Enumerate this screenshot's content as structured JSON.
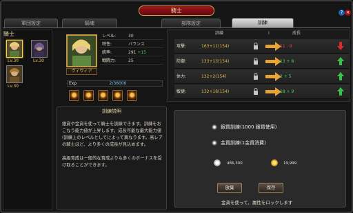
{
  "window": {
    "title": "騎士",
    "help": "?",
    "close": "×"
  },
  "tabs": [
    {
      "label": "軍団設定",
      "active": false
    },
    {
      "label": "騎魂",
      "active": false
    },
    {
      "label": "部隊設定",
      "active": false
    },
    {
      "label": "訓練",
      "active": true
    }
  ],
  "knight_list": {
    "heading": "騎士",
    "knights": [
      {
        "level": "Lv.30",
        "selected": true
      },
      {
        "level": "Lv.30",
        "selected": false
      },
      {
        "level": "Lv.30",
        "selected": false
      }
    ]
  },
  "knight": {
    "name": "ヴィヴィア",
    "stats": [
      {
        "label": "レベル:",
        "value": "30",
        "bonus": ""
      },
      {
        "label": "特性:",
        "value": "バランス",
        "bonus": ""
      },
      {
        "label": "統率:",
        "value": "291",
        "bonus": "+15"
      },
      {
        "label": "戦闘力:",
        "value": "25",
        "bonus": ""
      }
    ],
    "exp_label": "Exp",
    "exp_value": "2/36000"
  },
  "train_table": {
    "headers": {
      "train": "訓練",
      "mid": "I",
      "growth": "成長"
    },
    "rows": [
      {
        "name": "攻撃:",
        "value": "163+11(154)",
        "growth": "11 - 9",
        "trend": "down"
      },
      {
        "name": "防御:",
        "value": "133+13(154)",
        "growth": "13 + 8",
        "trend": "up"
      },
      {
        "name": "体力:",
        "value": "132+2(154)",
        "growth": "2 + 5",
        "trend": "up"
      },
      {
        "name": "敏捷:",
        "value": "132+18(154)",
        "growth": "18 + 9",
        "trend": "up"
      }
    ]
  },
  "description": {
    "title": "訓練説明",
    "paragraph1": "銀貨や金貨を使って騎士を訓練できます。訓練をおこなう能力値が上昇します。成長可能な最大能力値(訓練上のレベルとしてによって異なります。高レアの騎士ほど、より多くの成長が見込めます。",
    "paragraph2": "高級育成は一般的な育成よりも多くのボーナスを受け取ることができます。"
  },
  "options": {
    "silver_label": "銀貨訓練(1000 銀貨使用)",
    "gold_label": "金貨訓練(1金貨消費)",
    "silver_amount": "486,300",
    "gold_amount": "19,999",
    "cancel_label": "放棄",
    "save_label": "保存",
    "hint": "金貨を使って、属性をロックします"
  },
  "colors": {
    "accent_gold": "#c9a24a",
    "up": "#3cc24a",
    "down": "#d92a2a",
    "title_red": "#8c1015"
  }
}
